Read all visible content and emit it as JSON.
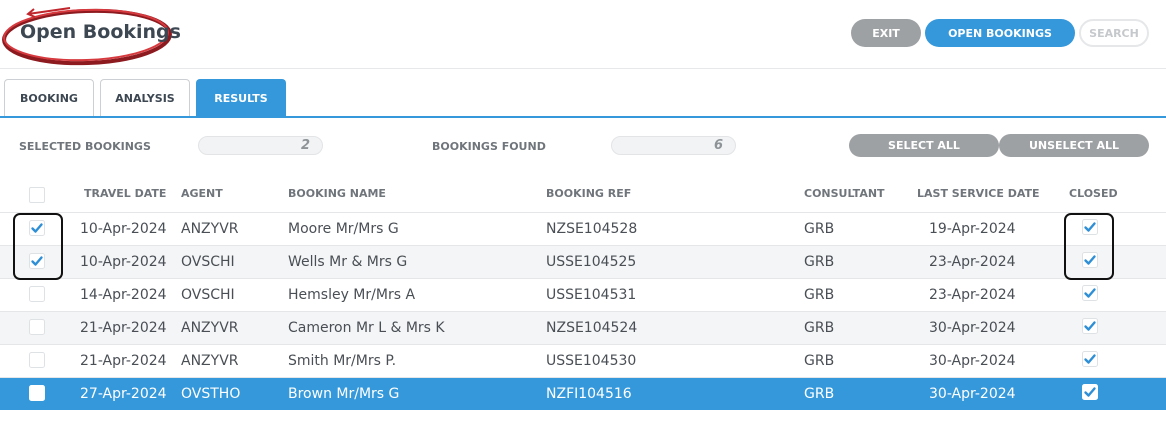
{
  "header": {
    "title": "Open Bookings",
    "buttons": {
      "exit": "EXIT",
      "open_bookings": "OPEN BOOKINGS",
      "search": "SEARCH"
    }
  },
  "tabs": [
    {
      "label": "BOOKING",
      "active": false
    },
    {
      "label": "ANALYSIS",
      "active": false
    },
    {
      "label": "RESULTS",
      "active": true
    }
  ],
  "summary": {
    "selected_label": "SELECTED BOOKINGS",
    "selected_count": "2",
    "found_label": "BOOKINGS FOUND",
    "found_count": "6",
    "select_all": "SELECT ALL",
    "unselect_all": "UNSELECT ALL"
  },
  "table": {
    "columns": [
      "TRAVEL DATE",
      "AGENT",
      "BOOKING NAME",
      "BOOKING REF",
      "CONSULTANT",
      "LAST SERVICE DATE",
      "CLOSED"
    ],
    "rows": [
      {
        "selected": true,
        "travel_date": "10-Apr-2024",
        "agent": "ANZYVR",
        "booking_name": "Moore Mr/Mrs G",
        "booking_ref": "NZSE104528",
        "consultant": "GRB",
        "last_service_date": "19-Apr-2024",
        "closed": true
      },
      {
        "selected": true,
        "travel_date": "10-Apr-2024",
        "agent": "OVSCHI",
        "booking_name": "Wells Mr & Mrs G",
        "booking_ref": "USSE104525",
        "consultant": "GRB",
        "last_service_date": "23-Apr-2024",
        "closed": true
      },
      {
        "selected": false,
        "travel_date": "14-Apr-2024",
        "agent": "OVSCHI",
        "booking_name": "Hemsley Mr/Mrs A",
        "booking_ref": "USSE104531",
        "consultant": "GRB",
        "last_service_date": "23-Apr-2024",
        "closed": true
      },
      {
        "selected": false,
        "travel_date": "21-Apr-2024",
        "agent": "ANZYVR",
        "booking_name": "Cameron Mr L & Mrs K",
        "booking_ref": "NZSE104524",
        "consultant": "GRB",
        "last_service_date": "30-Apr-2024",
        "closed": true
      },
      {
        "selected": false,
        "travel_date": "21-Apr-2024",
        "agent": "ANZYVR",
        "booking_name": "Smith Mr/Mrs P.",
        "booking_ref": "USSE104530",
        "consultant": "GRB",
        "last_service_date": "30-Apr-2024",
        "closed": true
      },
      {
        "selected": false,
        "travel_date": "27-Apr-2024",
        "agent": "OVSTHO",
        "booking_name": "Brown Mr/Mrs G",
        "booking_ref": "NZFI104516",
        "consultant": "GRB",
        "last_service_date": "30-Apr-2024",
        "closed": true
      }
    ]
  },
  "colors": {
    "accent": "#3498db",
    "grey_button": "#9ea1a4",
    "annotation_red": "#c0262c"
  },
  "icons": {
    "checkbox_tick": "check-icon"
  }
}
